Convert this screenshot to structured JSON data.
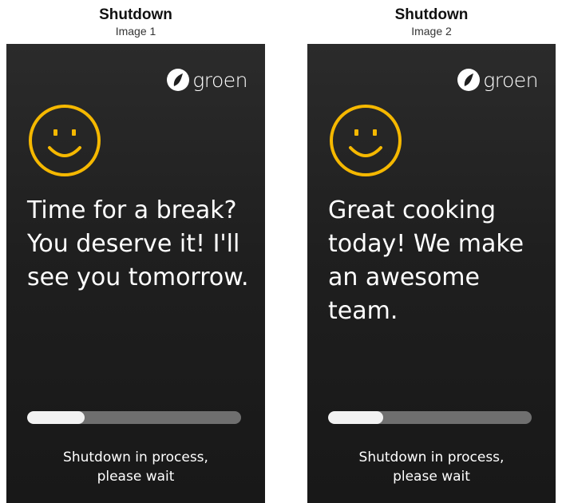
{
  "images": [
    {
      "caption_title": "Shutdown",
      "caption_sub": "Image 1",
      "logo_text": "groen",
      "message": "Time for a break? You deserve it! I'll see you tomorrow.",
      "progress": 0.27,
      "status_line1": "Shutdown in process,",
      "status_line2": "please wait"
    },
    {
      "caption_title": "Shutdown",
      "caption_sub": "Image 2",
      "logo_text": "groen",
      "message": "Great cooking today! We make an awesome team.",
      "progress": 0.27,
      "status_line1": "Shutdown in process,",
      "status_line2": "please wait"
    }
  ],
  "colors": {
    "smiley": "#f5b800",
    "background": "#1f1f1f",
    "progress_track": "#6f6f6f",
    "progress_fill": "#f2f2f2"
  },
  "icons": [
    "groen-logo-icon",
    "smiley-icon"
  ]
}
